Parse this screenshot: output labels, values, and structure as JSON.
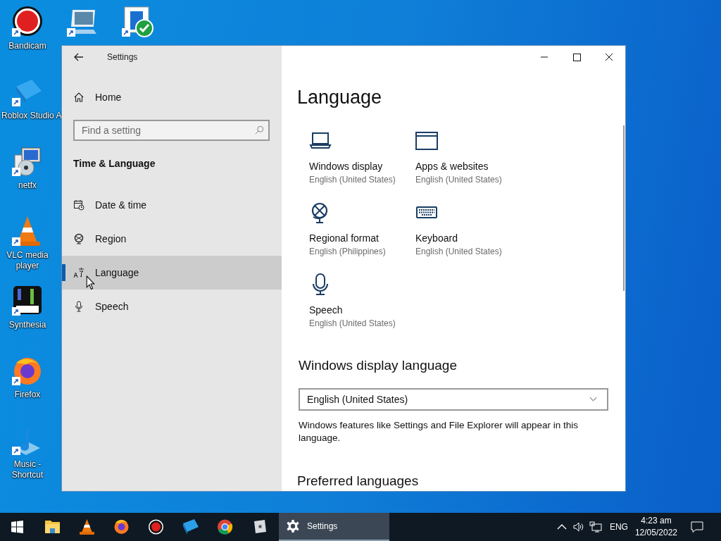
{
  "desktop": {
    "column": [
      {
        "kind": "bandicam",
        "label": "Bandicam"
      },
      {
        "kind": "roblox-studio",
        "label": "Roblox Studio A"
      },
      {
        "kind": "installer",
        "label": "netfx"
      },
      {
        "kind": "vlc",
        "label": "VLC media player"
      },
      {
        "kind": "synthesia",
        "label": "Synthesia"
      },
      {
        "kind": "firefox",
        "label": "Firefox"
      },
      {
        "kind": "music",
        "label": "Music - Shortcut"
      }
    ],
    "covered": [
      {
        "kind": "pictures"
      },
      {
        "kind": "default-apps"
      }
    ]
  },
  "window": {
    "title": "Settings",
    "sidebar": {
      "home": "Home",
      "search": {
        "placeholder": "Find a setting"
      },
      "section": "Time & Language",
      "items": [
        {
          "kind": "date",
          "label": "Date & time",
          "selected": false
        },
        {
          "kind": "region",
          "label": "Region",
          "selected": false
        },
        {
          "kind": "language",
          "label": "Language",
          "selected": true
        },
        {
          "kind": "speech",
          "label": "Speech",
          "selected": false
        }
      ]
    },
    "page": {
      "heading": "Language",
      "tiles": [
        {
          "kind": "laptop",
          "title": "Windows display",
          "subtitle": "English (United States)"
        },
        {
          "kind": "window",
          "title": "Apps & websites",
          "subtitle": "English (United States)"
        },
        {
          "kind": "globe",
          "title": "Regional format",
          "subtitle": "English (Philippines)"
        },
        {
          "kind": "keyboard",
          "title": "Keyboard",
          "subtitle": "English (United States)"
        },
        {
          "kind": "microphone",
          "title": "Speech",
          "subtitle": "English (United States)"
        }
      ],
      "display_language": {
        "heading": "Windows display language",
        "value": "English (United States)",
        "description": "Windows features like Settings and File Explorer will appear in this language."
      },
      "preferred_heading": "Preferred languages"
    }
  },
  "taskbar": {
    "apps": [
      {
        "kind": "explorer"
      },
      {
        "kind": "vlc"
      },
      {
        "kind": "firefox"
      },
      {
        "kind": "bandicam"
      },
      {
        "kind": "roblox-studio"
      },
      {
        "kind": "chrome"
      },
      {
        "kind": "roblox"
      }
    ],
    "active": {
      "label": "Settings",
      "selected": true
    },
    "tray": {
      "language": "ENG",
      "time": "4:23 am",
      "date": "12/05/2022"
    }
  }
}
